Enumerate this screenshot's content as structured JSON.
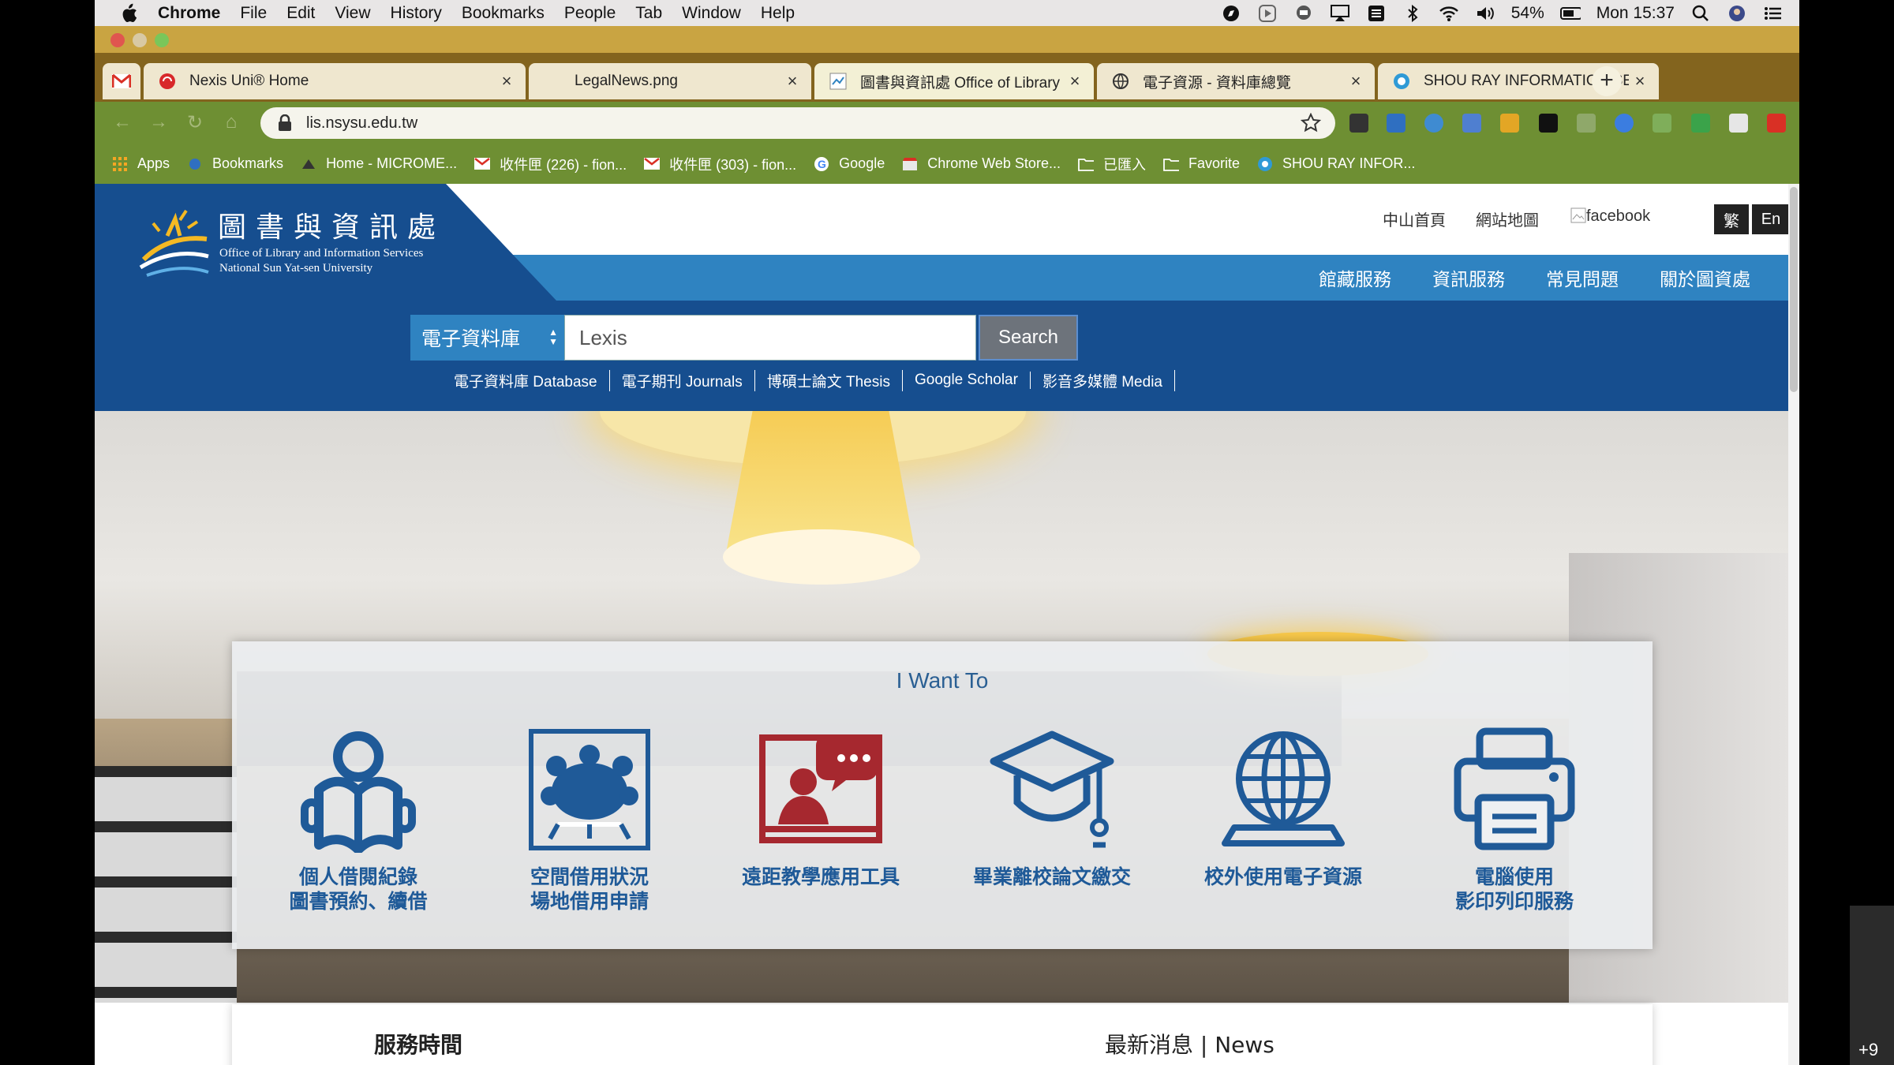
{
  "menubar": {
    "app": "Chrome",
    "items": [
      "File",
      "Edit",
      "View",
      "History",
      "Bookmarks",
      "People",
      "Tab",
      "Window",
      "Help"
    ],
    "battery": "54%",
    "clock": "Mon 15:37"
  },
  "tabs": [
    {
      "title": "Nexis Uni® Home",
      "icon": "nexis-icon"
    },
    {
      "title": "LegalNews.png",
      "icon": "file-icon"
    },
    {
      "title": "圖書與資訊處 Office of Library &",
      "icon": "library-icon"
    },
    {
      "title": "電子資源 - 資料庫總覽",
      "icon": "globe-icon"
    },
    {
      "title": "SHOU RAY INFORMATION SERV",
      "icon": "shouray-icon"
    }
  ],
  "omnibox": {
    "url": "lis.nsysu.edu.tw"
  },
  "bookmarks": [
    "Apps",
    "Bookmarks",
    "Home - MICROME...",
    "收件匣 (226) - fion...",
    "收件匣 (303) - fion...",
    "Google",
    "Chrome Web Store...",
    "已匯入",
    "Favorite",
    "SHOU RAY INFOR..."
  ],
  "site": {
    "logo": {
      "zh": "圖書與資訊處",
      "en1": "Office of Library and Information Services",
      "en2": "National Sun Yat-sen University"
    },
    "toplinks": {
      "home": "中山首頁",
      "sitemap": "網站地圖",
      "facebook": "facebook",
      "trad": "繁",
      "en": "En"
    },
    "nav": [
      "館藏服務",
      "資訊服務",
      "常見問題",
      "關於圖資處"
    ],
    "search": {
      "scope": "電子資料庫",
      "query": "Lexis",
      "button": "Search"
    },
    "sublinks": [
      "電子資料庫 Database",
      "電子期刊 Journals",
      "博碩士論文 Thesis",
      "Google Scholar",
      "影音多媒體 Media"
    ],
    "want": {
      "title": "I Want To",
      "items": [
        {
          "line1": "個人借閱紀錄",
          "line2": "圖書預約、續借",
          "icon": "reader-icon"
        },
        {
          "line1": "空間借用狀況",
          "line2": "場地借用申請",
          "icon": "meeting-room-icon"
        },
        {
          "line1": "遠距教學應用工具",
          "line2": "",
          "icon": "remote-teaching-icon"
        },
        {
          "line1": "畢業離校論文繳交",
          "line2": "",
          "icon": "graduation-cap-icon"
        },
        {
          "line1": "校外使用電子資源",
          "line2": "",
          "icon": "globe-laptop-icon"
        },
        {
          "line1": "電腦使用",
          "line2": "影印列印服務",
          "icon": "printer-icon"
        }
      ]
    },
    "below": {
      "hours": "服務時間",
      "news": "最新消息 | News"
    }
  },
  "overlay": {
    "count": "+9"
  },
  "colors": {
    "brand_dark": "#164e8f",
    "brand_light": "#2f83c1",
    "icon_blue": "#1f5a98",
    "icon_red": "#a6282f"
  }
}
